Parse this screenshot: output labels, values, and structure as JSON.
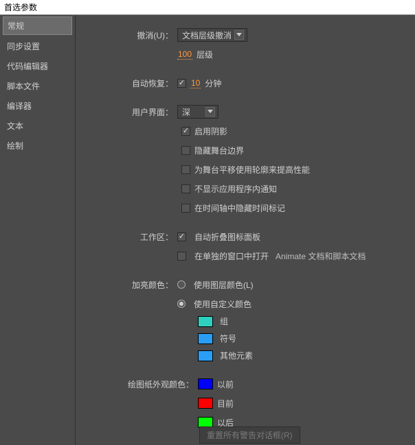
{
  "titleBar": "首选参数",
  "sidebar": {
    "items": [
      {
        "label": "常规",
        "selected": true
      },
      {
        "label": "同步设置",
        "selected": false
      },
      {
        "label": "代码编辑器",
        "selected": false
      },
      {
        "label": "脚本文件",
        "selected": false
      },
      {
        "label": "编译器",
        "selected": false
      },
      {
        "label": "文本",
        "selected": false
      },
      {
        "label": "绘制",
        "selected": false
      }
    ]
  },
  "undo": {
    "label": "撤消(U)：",
    "mode": "文档层级撤消",
    "levels_value": "100",
    "levels_suffix": "层级"
  },
  "autoRecover": {
    "label": "自动恢复：",
    "enabled": true,
    "minutes_value": "10",
    "minutes_suffix": "分钟"
  },
  "ui": {
    "label": "用户界面：",
    "theme": "深",
    "checks": [
      {
        "label": "启用阴影",
        "checked": true
      },
      {
        "label": "隐藏舞台边界",
        "checked": false
      },
      {
        "label": "为舞台平移使用轮廓来提高性能",
        "checked": false
      },
      {
        "label": "不显示应用程序内通知",
        "checked": false
      },
      {
        "label": "在时间轴中隐藏时间标记",
        "checked": false
      }
    ]
  },
  "workspace": {
    "label": "工作区：",
    "checks": [
      {
        "label": "自动折叠图标面板",
        "checked": true,
        "suffix": ""
      },
      {
        "label": "在单独的窗口中打开",
        "checked": false,
        "suffix": "Animate 文档和脚本文档"
      }
    ]
  },
  "highlight": {
    "label": "加亮颜色：",
    "radios": [
      {
        "label": "使用图层颜色(L)",
        "checked": false
      },
      {
        "label": "使用自定义颜色",
        "checked": true
      }
    ],
    "customColors": [
      {
        "label": "组",
        "color": "#2fd0c0"
      },
      {
        "label": "符号",
        "color": "#2a9df4"
      },
      {
        "label": "其他元素",
        "color": "#2a9df4"
      }
    ]
  },
  "onion": {
    "label": "绘图纸外观颜色：",
    "items": [
      {
        "label": "以前",
        "color": "#0000ff"
      },
      {
        "label": "目前",
        "color": "#ff0000"
      },
      {
        "label": "以后",
        "color": "#00ff00"
      }
    ]
  },
  "resetButton": "重置所有警告对话框(R)"
}
